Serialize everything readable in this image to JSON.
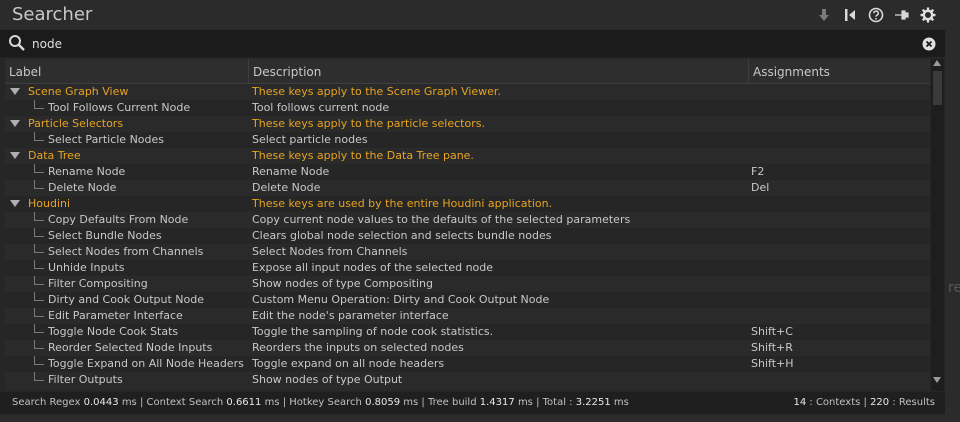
{
  "title": "Searcher",
  "toolbar_icons": [
    "download-icon",
    "pin-toggle-icon",
    "help-icon",
    "pin-icon",
    "gear-icon"
  ],
  "search": {
    "value": "node",
    "icon": "search-icon"
  },
  "columns": [
    "Label",
    "Description",
    "Assignments"
  ],
  "rows": [
    {
      "type": "context",
      "label": "Scene Graph View",
      "description": "These keys apply to the Scene Graph Viewer.",
      "assignment": ""
    },
    {
      "type": "item",
      "label": "Tool Follows Current Node",
      "description": "Tool follows current node",
      "assignment": ""
    },
    {
      "type": "context",
      "label": "Particle Selectors",
      "description": "These keys apply to the particle selectors.",
      "assignment": ""
    },
    {
      "type": "item",
      "label": "Select Particle Nodes",
      "description": "Select particle nodes",
      "assignment": ""
    },
    {
      "type": "context",
      "label": "Data Tree",
      "description": "These keys apply to the Data Tree pane.",
      "assignment": ""
    },
    {
      "type": "item",
      "label": "Rename Node",
      "description": "Rename Node",
      "assignment": "F2"
    },
    {
      "type": "item",
      "label": "Delete Node",
      "description": "Delete Node",
      "assignment": "Del"
    },
    {
      "type": "context",
      "label": "Houdini",
      "description": "These keys are used by the entire Houdini application.",
      "assignment": ""
    },
    {
      "type": "item",
      "label": "Copy Defaults From Node",
      "description": "Copy current node values to the defaults of the selected parameters",
      "assignment": ""
    },
    {
      "type": "item",
      "label": "Select Bundle Nodes",
      "description": "Clears global node selection and selects bundle nodes",
      "assignment": ""
    },
    {
      "type": "item",
      "label": "Select Nodes from Channels",
      "description": "Select Nodes from Channels",
      "assignment": ""
    },
    {
      "type": "item",
      "label": "Unhide Inputs",
      "description": "Expose all input nodes of the selected node",
      "assignment": ""
    },
    {
      "type": "item",
      "label": "Filter Compositing",
      "description": "Show nodes of type Compositing",
      "assignment": ""
    },
    {
      "type": "item",
      "label": "Dirty and Cook Output Node",
      "description": "Custom Menu Operation: Dirty and Cook Output Node",
      "assignment": ""
    },
    {
      "type": "item",
      "label": "Edit Parameter Interface",
      "description": "Edit the node's parameter interface",
      "assignment": ""
    },
    {
      "type": "item",
      "label": "Toggle Node Cook Stats",
      "description": "Toggle the sampling of node cook statistics.",
      "assignment": "Shift+C"
    },
    {
      "type": "item",
      "label": "Reorder Selected Node Inputs",
      "description": "Reorders the inputs on selected nodes",
      "assignment": "Shift+R"
    },
    {
      "type": "item",
      "label": "Toggle Expand on All Node Headers",
      "description": "Toggle expand on all node headers",
      "assignment": "Shift+H"
    },
    {
      "type": "item",
      "label": "Filter Outputs",
      "description": "Show nodes of type Output",
      "assignment": ""
    }
  ],
  "status": {
    "regex_label": "Search Regex",
    "regex_value": "0.0443",
    "context_label": "Context Search",
    "context_value": "0.6611",
    "hotkey_label": "Hotkey Search",
    "hotkey_value": "0.8059",
    "tree_label": "Tree build",
    "tree_value": "1.4317",
    "total_label": "Total :",
    "total_value": "3.2251",
    "unit": "ms",
    "contexts_count": "14",
    "contexts_label": ": Contexts",
    "results_count": "220",
    "results_label": ": Results"
  },
  "edge_text": "re",
  "colors": {
    "context": "#e8a422",
    "text": "#c8c8c8",
    "background": "#262626"
  }
}
